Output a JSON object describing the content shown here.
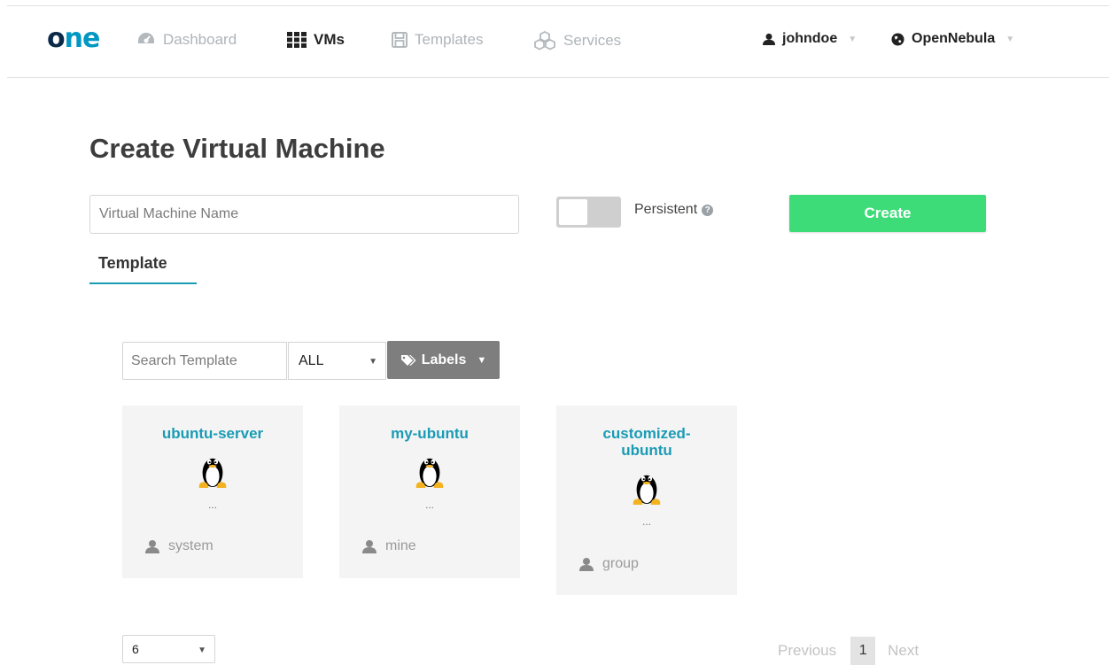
{
  "brand": {
    "logo_o": "o",
    "logo_ne": "ne"
  },
  "nav": {
    "dashboard": "Dashboard",
    "vms": "VMs",
    "templates": "Templates",
    "services": "Services",
    "user": "johndoe",
    "zone": "OpenNebula"
  },
  "page_title": "Create Virtual Machine",
  "vm_name": {
    "placeholder": "Virtual Machine Name",
    "value": ""
  },
  "persistent": {
    "label": "Persistent",
    "enabled": false,
    "help_icon": "?"
  },
  "create_label": "Create",
  "tab_label": "Template",
  "filters": {
    "search_placeholder": "Search Template",
    "owner_filter": "ALL",
    "labels_label": "Labels"
  },
  "templates": [
    {
      "name": "ubuntu-server",
      "description": "...",
      "owner": "system"
    },
    {
      "name": "my-ubuntu",
      "description": "...",
      "owner": "mine"
    },
    {
      "name": "customized-ubuntu",
      "description": "...",
      "owner": "group"
    }
  ],
  "pagination": {
    "page_size": "6",
    "previous": "Previous",
    "current_page": "1",
    "next": "Next"
  },
  "colors": {
    "accent": "#1a9bb5",
    "create_button": "#3ddc79",
    "labels_button": "#7e7e7e",
    "card_bg": "#f4f4f4"
  }
}
